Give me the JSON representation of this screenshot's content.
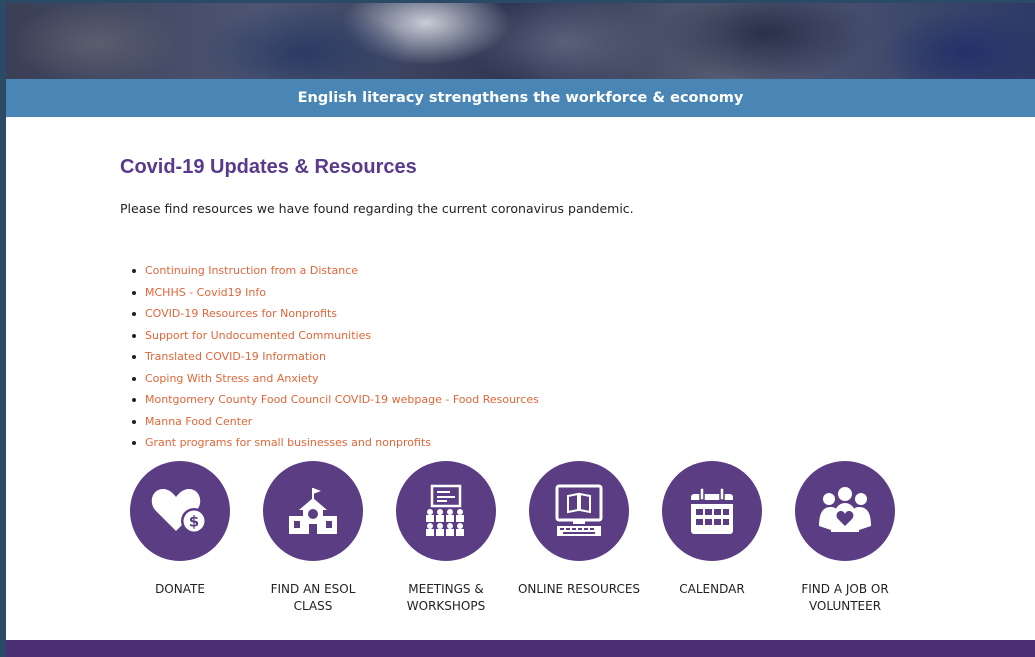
{
  "banner": {
    "text": "English literacy strengthens the workforce & economy"
  },
  "main": {
    "title": "Covid-19 Updates & Resources",
    "intro": "Please find resources we have found regarding the current coronavirus pandemic.",
    "links": [
      "Continuing Instruction from a Distance",
      "MCHHS - Covid19 Info",
      "COVID-19 Resources for Nonprofits",
      "Support for Undocumented Communities",
      "Translated COVID-19 Information",
      "Coping With Stress and Anxiety",
      "Montgomery County Food Council COVID-19 webpage - Food Resources",
      "Manna Food Center",
      "Grant programs for small businesses and nonprofits"
    ]
  },
  "tiles": [
    {
      "label": "DONATE",
      "icon": "heart-dollar-icon"
    },
    {
      "label": "FIND AN ESOL CLASS",
      "icon": "school-building-icon"
    },
    {
      "label": "MEETINGS & WORKSHOPS",
      "icon": "presentation-audience-icon"
    },
    {
      "label": "ONLINE RESOURCES",
      "icon": "computer-book-icon"
    },
    {
      "label": "CALENDAR",
      "icon": "calendar-icon"
    },
    {
      "label": "FIND A JOB OR VOLUNTEER",
      "icon": "people-heart-icon"
    }
  ],
  "colors": {
    "accent": "#5b3d84",
    "banner": "#4a86b5",
    "link": "#e0663a",
    "footer": "#4b2f73"
  }
}
